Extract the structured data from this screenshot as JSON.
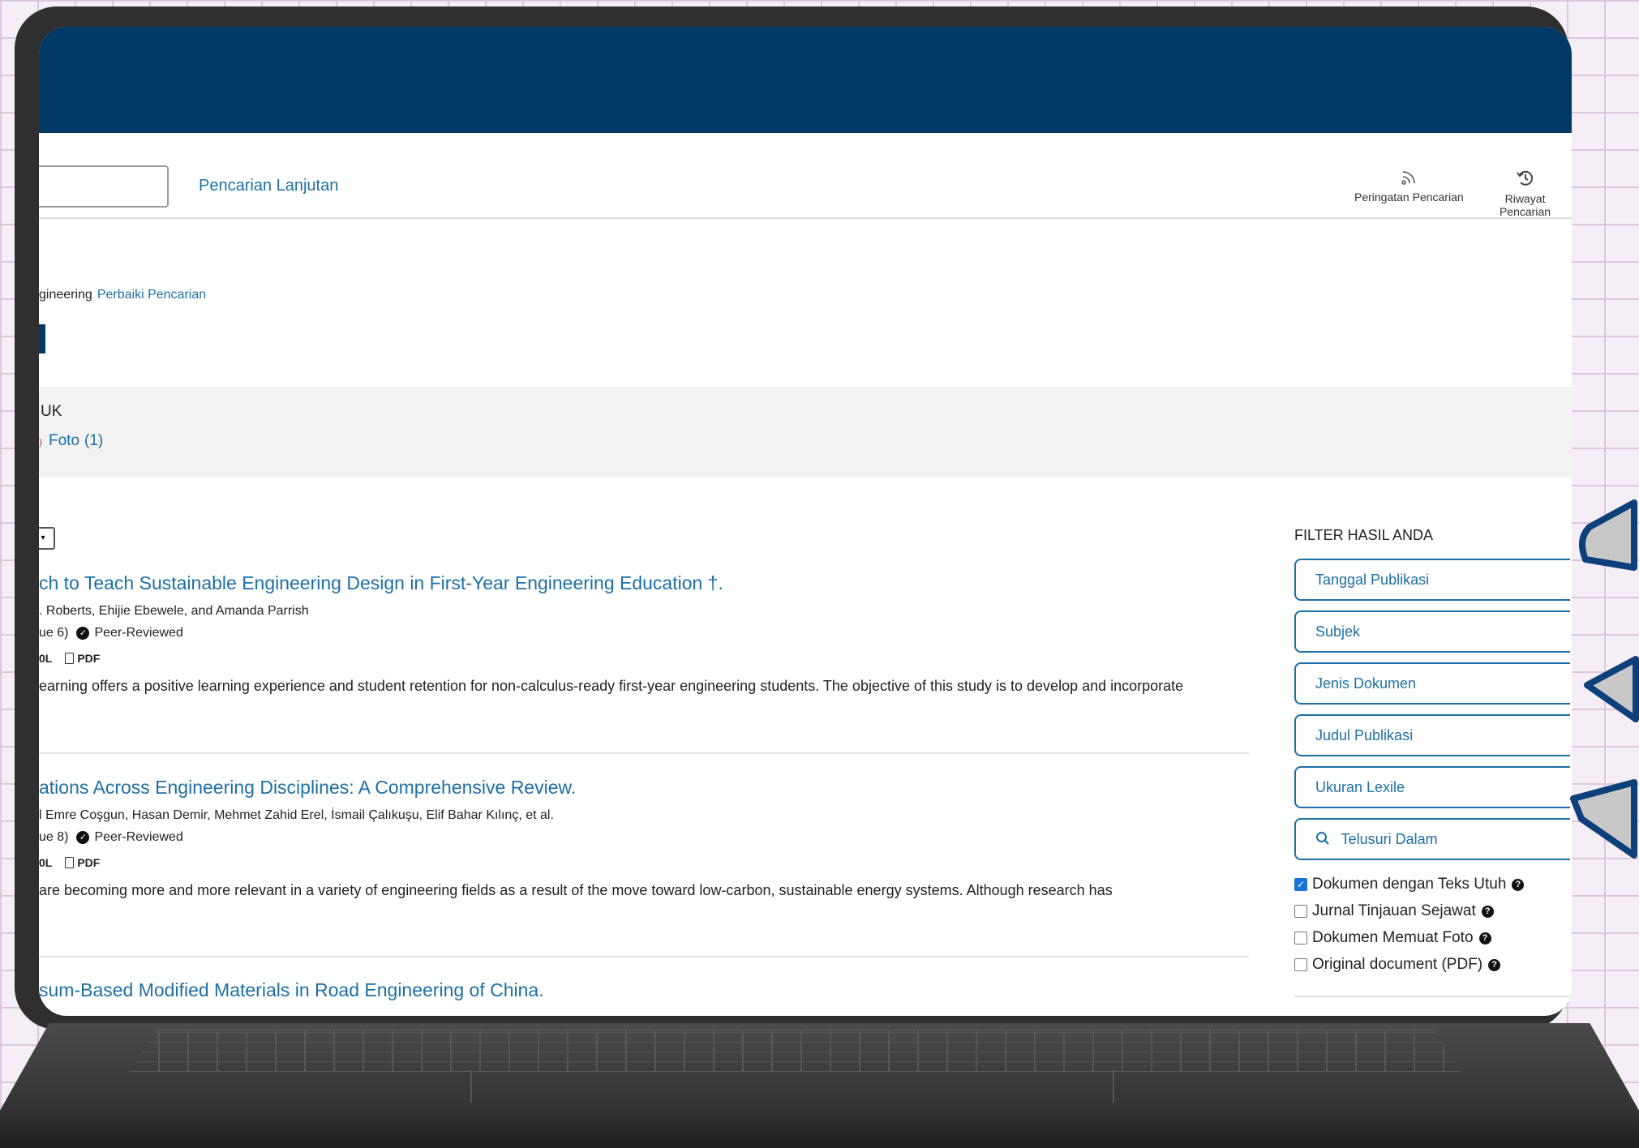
{
  "header": {
    "advanced_search": "Pencarian Lanjutan",
    "search_alert": "Peringatan Pencarian",
    "search_history": "Riwayat Pencarian"
  },
  "breadcrumb": {
    "term": "gineering",
    "refine": "Perbaiki Pencarian"
  },
  "source_band": {
    "title": "UK",
    "item": "Foto",
    "count": "(1)"
  },
  "results": [
    {
      "title": "ch to Teach Sustainable Engineering Design in First-Year Engineering Education †.",
      "authors": ". Roberts, Ehijie Ebewele, and Amanda Parrish",
      "issue": "ue 6)",
      "peer": "Peer-Reviewed",
      "lexile": "0L",
      "pdf": "PDF",
      "abstract": "earning offers a positive learning experience and student retention for non-calculus-ready first-year engineering students. The objective of this study is to develop and incorporate"
    },
    {
      "title": "ations Across Engineering Disciplines: A Comprehensive Review.",
      "authors": "l Emre Coşgun, Hasan Demir, Mehmet Zahid Erel, İsmail Çalıkuşu, Elif Bahar Kılınç, et al.",
      "issue": "ue 8)",
      "peer": "Peer-Reviewed",
      "lexile": "0L",
      "pdf": "PDF",
      "abstract": " are becoming more and more relevant in a variety of engineering fields as a result of the move toward low-carbon, sustainable energy systems. Although research has"
    },
    {
      "title": "sum-Based Modified Materials in Road Engineering of China."
    }
  ],
  "filters": {
    "heading": "FILTER HASIL ANDA",
    "buttons": [
      "Tanggal Publikasi",
      "Subjek",
      "Jenis Dokumen",
      "Judul Publikasi",
      "Ukuran Lexile"
    ],
    "search_within": "Telusuri Dalam",
    "checkboxes": [
      {
        "label": "Dokumen dengan Teks Utuh",
        "checked": true
      },
      {
        "label": "Jurnal Tinjauan Sejawat",
        "checked": false
      },
      {
        "label": "Dokumen Memuat Foto",
        "checked": false
      },
      {
        "label": "Original document (PDF)",
        "checked": false
      }
    ]
  },
  "colors": {
    "header": "#003966",
    "link": "#1d6fa6",
    "frame": "#2f2f2f",
    "grid_bg": "#f6eef6"
  },
  "icons": [
    "rss-icon",
    "history-icon",
    "check-circle-icon",
    "pdf-icon",
    "search-icon",
    "help-icon"
  ]
}
